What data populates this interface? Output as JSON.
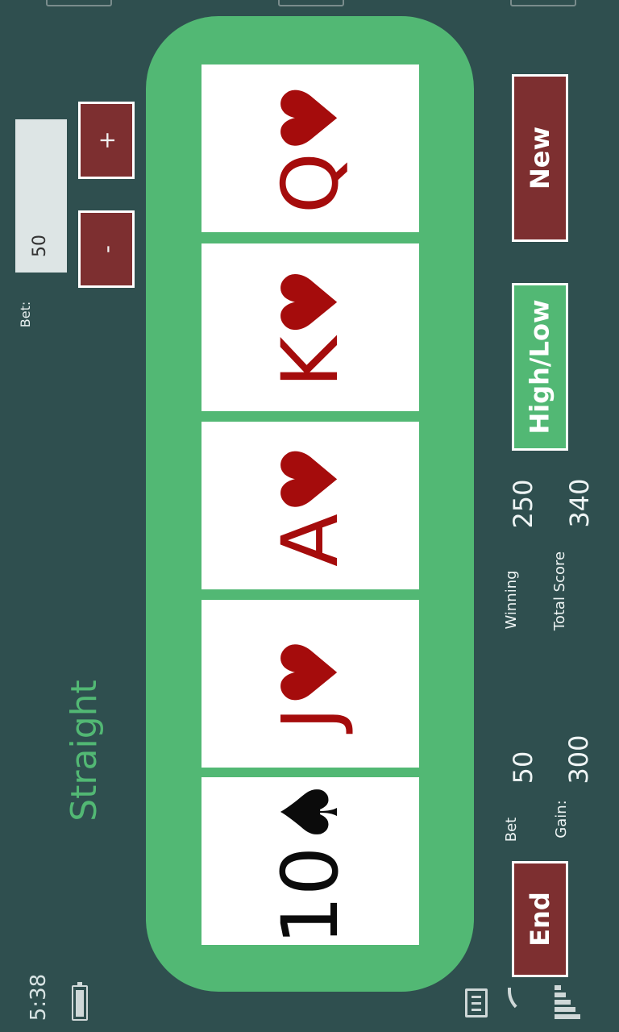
{
  "status_bar": {
    "time": "5:38"
  },
  "bet_control": {
    "label": "Bet:",
    "value": "50",
    "increase_label": "+",
    "decrease_label": "-"
  },
  "hand_result": "Straight",
  "cards": [
    {
      "rank": "Q",
      "suit": "♥",
      "color": "red"
    },
    {
      "rank": "K",
      "suit": "♥",
      "color": "red"
    },
    {
      "rank": "A",
      "suit": "♥",
      "color": "red"
    },
    {
      "rank": "J",
      "suit": "♥",
      "color": "red"
    },
    {
      "rank": "10",
      "suit": "♠",
      "color": "black"
    }
  ],
  "scores": {
    "bet_label": "Bet",
    "bet_value": "50",
    "gain_label": "Gain:",
    "gain_value": "300",
    "winning_label": "Winning",
    "winning_value": "250",
    "total_label": "Total Score",
    "total_value": "340"
  },
  "buttons": {
    "new": "New",
    "high_low": "High/Low",
    "end": "End"
  },
  "colors": {
    "background": "#2f4f4f",
    "felt": "#52b874",
    "button_red": "#7d2f30",
    "heart_red": "#a50c0c"
  }
}
